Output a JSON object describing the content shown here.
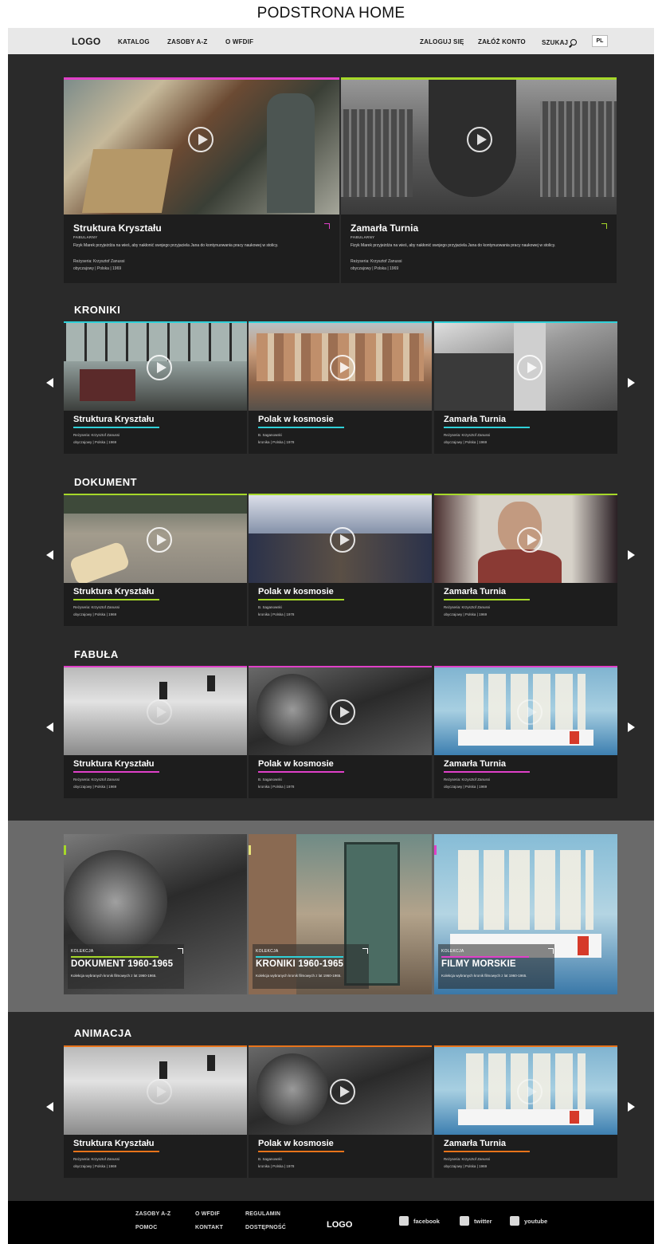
{
  "caption": "PODSTRONA HOME",
  "nav": {
    "logo": "LOGO",
    "left_links": [
      "KATALOG",
      "ZASOBY A-Z",
      "O WFDIF"
    ],
    "login": "ZALOGUJ SIĘ",
    "register": "ZAŁÓŻ KONTO",
    "search": "SZUKAJ",
    "lang": "PL"
  },
  "hero": [
    {
      "title": "Struktura Kryształu",
      "genre": "FABULARNY",
      "desc": "Fizyk Marek przyjeżdża na wieś, aby nakłonić swojego przyjaciela Jana do kontynuowania pracy naukowej w stolicy.",
      "director": "Reżyseria: Krzysztof Zanussi",
      "meta": "obyczajowy  |  Polska  |  1969"
    },
    {
      "title": "Zamarła Turnia",
      "genre": "FABULARNY",
      "desc": "Fizyk Marek przyjeżdża na wieś, aby nakłonić swojego przyjaciela Jana do kontynuowania pracy naukowej w stolicy.",
      "director": "Reżyseria: Krzysztof Zanussi",
      "meta": "obyczajowy  |  Polska  |  1969"
    }
  ],
  "sections": [
    {
      "title": "KRONIKI",
      "cards": [
        {
          "title": "Struktura Kryształu",
          "line1": "Reżyseria: Krzysztof Zanussi",
          "line2": "obyczajowy  |  Polska  |  1969"
        },
        {
          "title": "Polak w kosmosie",
          "line1": "B. Saganowski",
          "line2": "kronika  |  Polska  |  1978"
        },
        {
          "title": "Zamarła Turnia",
          "line1": "Reżyseria: Krzysztof Zanussi",
          "line2": "obyczajowy  |  Polska  |  1969"
        }
      ]
    },
    {
      "title": "DOKUMENT",
      "cards": [
        {
          "title": "Struktura Kryształu",
          "line1": "Reżyseria: Krzysztof Zanussi",
          "line2": "obyczajowy  |  Polska  |  1969"
        },
        {
          "title": "Polak w kosmosie",
          "line1": "B. Saganowski",
          "line2": "kronika  |  Polska  |  1978"
        },
        {
          "title": "Zamarła Turnia",
          "line1": "Reżyseria: Krzysztof Zanussi",
          "line2": "obyczajowy  |  Polska  |  1969"
        }
      ]
    },
    {
      "title": "FABUŁA",
      "cards": [
        {
          "title": "Struktura Kryształu",
          "line1": "Reżyseria: Krzysztof Zanussi",
          "line2": "obyczajowy  |  Polska  |  1969"
        },
        {
          "title": "Polak w kosmosie",
          "line1": "B. Saganowski",
          "line2": "kronika  |  Polska  |  1978"
        },
        {
          "title": "Zamarła Turnia",
          "line1": "Reżyseria: Krzysztof Zanussi",
          "line2": "obyczajowy  |  Polska  |  1969"
        }
      ]
    },
    {
      "title": "ANIMACJA",
      "cards": [
        {
          "title": "Struktura Kryształu",
          "line1": "Reżyseria: Krzysztof Zanussi",
          "line2": "obyczajowy  |  Polska  |  1969"
        },
        {
          "title": "Polak w kosmosie",
          "line1": "B. Saganowski",
          "line2": "kronika  |  Polska  |  1978"
        },
        {
          "title": "Zamarła Turnia",
          "line1": "Reżyseria: Krzysztof Zanussi",
          "line2": "obyczajowy  |  Polska  |  1969"
        }
      ]
    }
  ],
  "collections": [
    {
      "label": "KOLEKCJA",
      "title": "DOKUMENT 1960-1965",
      "desc": "Kolekcja wybranych kronik filmowych z lat 1960-1965."
    },
    {
      "label": "KOLEKCJA",
      "title": "KRONIKI 1960-1965",
      "desc": "Kolekcja wybranych kronik filmowych z lat 1960-1965."
    },
    {
      "label": "KOLEKCJA",
      "title": "FILMY MORSKIE",
      "desc": "Kolekcja wybranych kronik filmowych z lat 1960-1965."
    }
  ],
  "footer": {
    "col1": [
      "ZASOBY A-Z",
      "POMOC"
    ],
    "col2": [
      "O WFDIF",
      "KONTAKT"
    ],
    "col3": [
      "REGULAMIN",
      "DOSTĘPNOŚĆ"
    ],
    "logo": "LOGO",
    "social": [
      "facebook",
      "twitter",
      "youtube"
    ]
  },
  "colors": {
    "magenta": "#e040c8",
    "lime": "#a6d829",
    "cyan": "#2fd0d8",
    "orange": "#e8731a"
  }
}
